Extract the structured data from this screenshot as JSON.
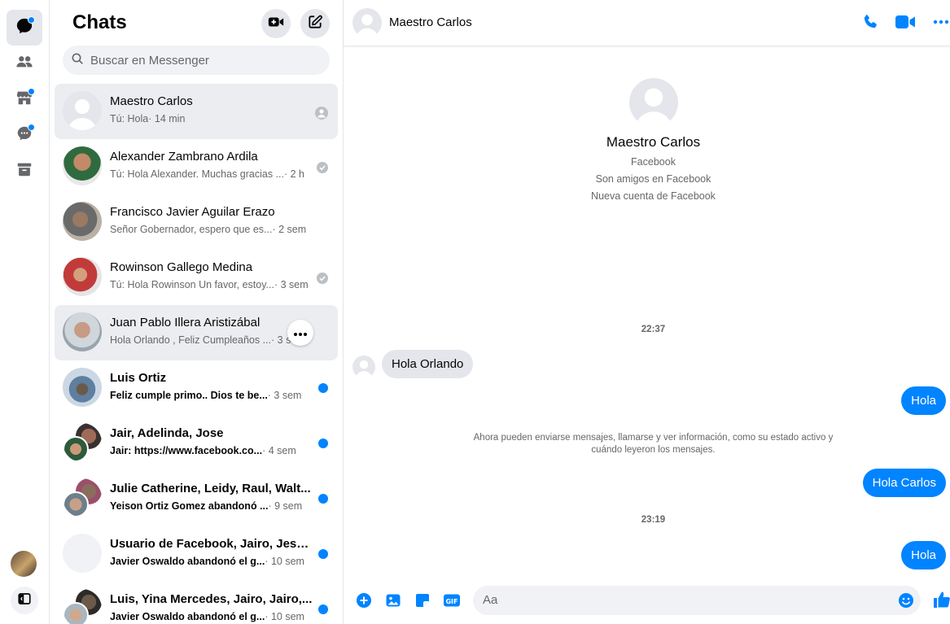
{
  "colors": {
    "accent": "#0084ff",
    "bubble_in": "#e4e6eb",
    "muted": "#65676b"
  },
  "list": {
    "title": "Chats",
    "search_placeholder": "Buscar en Messenger",
    "chats": [
      {
        "name": "Maestro Carlos",
        "preview": "Tú: Hola",
        "time": " · 14 min",
        "status": "seen-avatar",
        "unread": false
      },
      {
        "name": "Alexander Zambrano Ardila",
        "preview": "Tú: Hola Alexander. Muchas gracias ...",
        "time": " · 2 h",
        "status": "sent",
        "unread": false
      },
      {
        "name": "Francisco Javier Aguilar Erazo",
        "preview": "Señor Gobernador, espero que es...",
        "time": " · 2 sem",
        "status": "none",
        "unread": false
      },
      {
        "name": "Rowinson Gallego Medina",
        "preview": "Tú: Hola Rowinson Un favor, estoy...",
        "time": " · 3 sem",
        "status": "sent",
        "unread": false
      },
      {
        "name": "Juan Pablo Illera Aristizábal",
        "preview": "Hola Orlando , Feliz Cumpleaños ...",
        "time": " · 3 sem",
        "status": "more",
        "unread": false
      },
      {
        "name": "Luis Ortiz",
        "preview": "Feliz cumple primo.. Dios te be...",
        "time": " · 3 sem",
        "status": "unread",
        "unread": true
      },
      {
        "name": "Jair, Adelinda, Jose",
        "preview": "Jair: https://www.facebook.co...",
        "time": " · 4 sem",
        "status": "unread",
        "unread": true
      },
      {
        "name": "Julie Catherine, Leidy, Raul, Walt...",
        "preview": "Yeison Ortiz Gomez abandonó ...",
        "time": " · 9 sem",
        "status": "unread",
        "unread": true
      },
      {
        "name": "Usuario de Facebook, Jairo, Jesu...",
        "preview": "Javier Oswaldo abandonó el g...",
        "time": " · 10 sem",
        "status": "unread",
        "unread": true
      },
      {
        "name": "Luis, Yina Mercedes, Jairo, Jairo,...",
        "preview": "Javier Oswaldo abandonó el g...",
        "time": " · 10 sem",
        "status": "unread",
        "unread": true
      }
    ]
  },
  "conversation": {
    "name": "Maestro Carlos",
    "profile": {
      "name": "Maestro Carlos",
      "line1": "Facebook",
      "line2": "Son amigos en Facebook",
      "line3": "Nueva cuenta de Facebook"
    },
    "messages": {
      "time1": "22:37",
      "in1": "Hola Orlando",
      "out1": "Hola",
      "system": "Ahora pueden enviarse mensajes, llamarse y ver información, como su estado activo y cuándo leyeron los mensajes.",
      "out2": "Hola Carlos",
      "time2": "23:19",
      "out3": "Hola"
    },
    "composer_placeholder": "Aa"
  },
  "icons": {
    "rail": [
      "chat-icon",
      "people-icon",
      "marketplace-icon",
      "requests-icon",
      "archive-icon"
    ],
    "header": [
      "video-add-icon",
      "compose-icon"
    ],
    "conv_header": [
      "phone-icon",
      "video-icon",
      "more-icon"
    ],
    "composer": [
      "plus-icon",
      "image-icon",
      "sticker-icon",
      "gif-icon",
      "emoji-icon",
      "like-icon"
    ]
  }
}
